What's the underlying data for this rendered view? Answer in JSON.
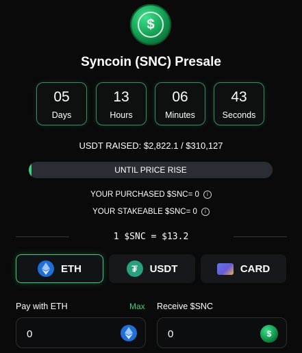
{
  "presale": {
    "logo_symbol": "$",
    "title": "Syncoin (SNC) Presale",
    "countdown": [
      {
        "value": "05",
        "label": "Days"
      },
      {
        "value": "13",
        "label": "Hours"
      },
      {
        "value": "06",
        "label": "Minutes"
      },
      {
        "value": "43",
        "label": "Seconds"
      }
    ],
    "raised_text": "USDT RAISED: $2,822.1 / $310,127",
    "progress": {
      "label": "UNTIL PRICE RISE",
      "fraction": 0.01
    },
    "purchased_text": "YOUR PURCHASED $SNC= 0",
    "stakeable_text": "YOUR STAKEABLE $SNC= 0",
    "info_symbol": "i",
    "rate_text": "1 $SNC = $13.2",
    "payment_methods": [
      {
        "label": "ETH",
        "icon": "eth-icon",
        "selected": true
      },
      {
        "label": "USDT",
        "icon": "usdt-icon",
        "selected": false
      },
      {
        "label": "CARD",
        "icon": "card-icon",
        "selected": false
      }
    ],
    "usdt_symbol": "₮",
    "pay_label": "Pay with ETH",
    "max_label": "Max",
    "pay_value": "0",
    "receive_label": "Receive $SNC",
    "receive_value": "0",
    "colors": {
      "accent": "#3bd07f",
      "background": "#0a0a0a",
      "eth": "#1f6fd6",
      "usdt": "#26a17b"
    }
  }
}
